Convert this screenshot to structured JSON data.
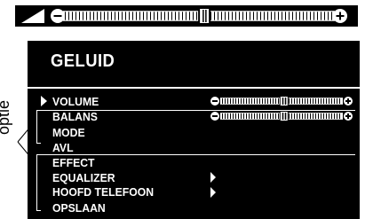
{
  "page": {
    "annotation_label": "optie"
  },
  "top_volume_bar": {
    "level": 0.52
  },
  "menu": {
    "title": "GELUID",
    "items": [
      {
        "label": "VOLUME",
        "selected": true,
        "control": "slider",
        "level": 0.52
      },
      {
        "label": "BALANS",
        "control": "slider",
        "level": 0.52
      },
      {
        "label": "MODE"
      },
      {
        "label": "AVL"
      },
      {
        "label": "EFFECT"
      },
      {
        "label": "EQUALIZER",
        "control": "submenu-arrow"
      },
      {
        "label": "HOOFD TELEFOON",
        "control": "submenu-arrow"
      },
      {
        "label": "OPSLAAN"
      }
    ]
  },
  "colors": {
    "panel": "#000000",
    "text": "#ffffff",
    "page": "#ffffff"
  }
}
